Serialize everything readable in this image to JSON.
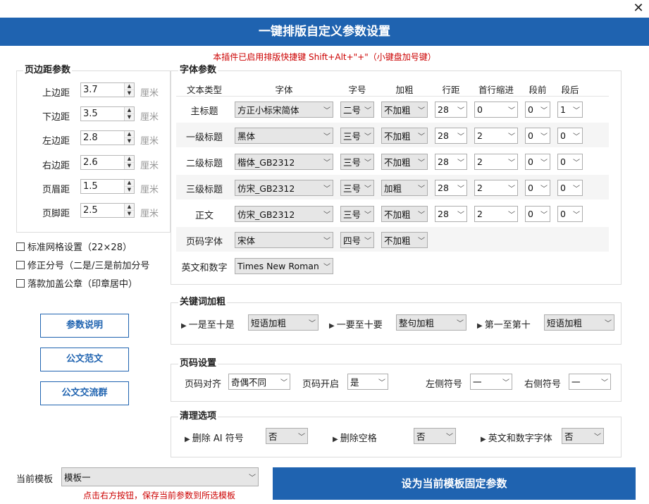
{
  "window": {
    "close_glyph": "✕"
  },
  "header": {
    "title": "一键排版自定义参数设置"
  },
  "hint": "本插件已启用排版快捷键 Shift+Alt+\"+\"（小键盘加号键）",
  "margins": {
    "title": "页边距参数",
    "unit": "厘米",
    "rows": [
      {
        "label": "上边距",
        "value": "3.7"
      },
      {
        "label": "下边距",
        "value": "3.5"
      },
      {
        "label": "左边距",
        "value": "2.8"
      },
      {
        "label": "右边距",
        "value": "2.6"
      },
      {
        "label": "页眉距",
        "value": "1.5"
      },
      {
        "label": "页脚距",
        "value": "2.5"
      }
    ]
  },
  "checkboxes": [
    {
      "label": "标准网格设置（22×28）",
      "checked": false
    },
    {
      "label": "修正分号（二是/三是前加分号",
      "checked": false
    },
    {
      "label": "落款加盖公章（印章居中）",
      "checked": false
    }
  ],
  "left_buttons": {
    "help": "参数说明",
    "sample": "公文范文",
    "group": "公文交流群"
  },
  "font": {
    "title": "字体参数",
    "headers": [
      "文本类型",
      "字体",
      "字号",
      "加粗",
      "行距",
      "首行缩进",
      "段前",
      "段后"
    ],
    "rows": [
      {
        "type": "主标题",
        "font": "方正小标宋简体",
        "size": "二号",
        "bold": "不加粗",
        "line": "28",
        "indent": "0",
        "before": "0",
        "after": "1"
      },
      {
        "type": "一级标题",
        "font": "黑体",
        "size": "三号",
        "bold": "不加粗",
        "line": "28",
        "indent": "2",
        "before": "0",
        "after": "0"
      },
      {
        "type": "二级标题",
        "font": "楷体_GB2312",
        "size": "三号",
        "bold": "不加粗",
        "line": "28",
        "indent": "2",
        "before": "0",
        "after": "0"
      },
      {
        "type": "三级标题",
        "font": "仿宋_GB2312",
        "size": "三号",
        "bold": "加粗",
        "line": "28",
        "indent": "2",
        "before": "0",
        "after": "0"
      },
      {
        "type": "正文",
        "font": "仿宋_GB2312",
        "size": "三号",
        "bold": "不加粗",
        "line": "28",
        "indent": "2",
        "before": "0",
        "after": "0"
      },
      {
        "type": "页码字体",
        "font": "宋体",
        "size": "四号",
        "bold": "不加粗"
      },
      {
        "type": "英文和数字",
        "font": "Times New Roman"
      }
    ]
  },
  "keyword": {
    "title": "关键词加粗",
    "items": [
      {
        "label": "一是至十是",
        "value": "短语加粗"
      },
      {
        "label": "一要至十要",
        "value": "整句加粗"
      },
      {
        "label": "第一至第十",
        "value": "短语加粗"
      }
    ]
  },
  "page_number": {
    "title": "页码设置",
    "align_label": "页码对齐",
    "align_value": "奇偶不同",
    "enable_label": "页码开启",
    "enable_value": "是",
    "left_label": "左侧符号",
    "left_value": "一",
    "right_label": "右侧符号",
    "right_value": "一"
  },
  "cleanup": {
    "title": "清理选项",
    "items": [
      {
        "label": "删除 AI 符号",
        "value": "否"
      },
      {
        "label": "删除空格",
        "value": "否"
      },
      {
        "label": "英文和数字字体",
        "value": "否"
      }
    ]
  },
  "template": {
    "label": "当前模板",
    "value": "模板一",
    "hint": "点击右方按钮，保存当前参数到所选模板",
    "set_button": "设为当前模板固定参数"
  },
  "colors": {
    "accent": "#1f63b0",
    "hint": "#cc0000"
  }
}
